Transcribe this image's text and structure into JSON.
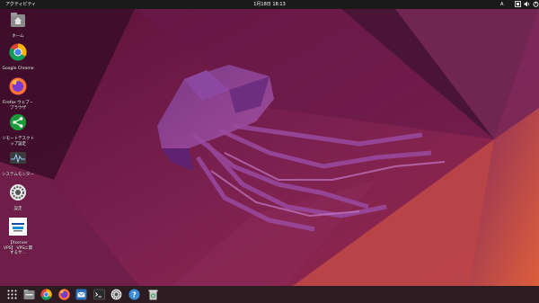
{
  "topbar": {
    "activities": "アクティビティ",
    "clock": "1月18日 18:13",
    "input_method": "A"
  },
  "desktop": {
    "items": [
      {
        "label": "ホーム",
        "icon": "home-folder-icon"
      },
      {
        "label": "Google Chrome",
        "icon": "chrome-icon"
      },
      {
        "label": "Firefox ウェブ・ブラウザ",
        "icon": "firefox-icon"
      },
      {
        "label": "リモートデスクトップ設定",
        "icon": "remote-desktop-icon"
      },
      {
        "label": "システムモニター",
        "icon": "system-monitor-icon"
      },
      {
        "label": "設定",
        "icon": "settings-icon"
      },
      {
        "label": "【Xserver VPS】 VPSに関するサ…",
        "icon": "xserver-vps-icon"
      }
    ]
  },
  "dock": {
    "items": [
      "app-grid-icon",
      "files-icon",
      "chrome-icon",
      "firefox-icon",
      "mail-icon",
      "terminal-icon",
      "settings-icon",
      "help-icon",
      "trash-icon"
    ]
  },
  "colors": {
    "topbar": "#1a1a1a",
    "dock": "#2c1c22",
    "wallpaper_dark": "#3a0f2a",
    "wallpaper_mid": "#8a2a5a",
    "wallpaper_accent": "#d9533a"
  }
}
